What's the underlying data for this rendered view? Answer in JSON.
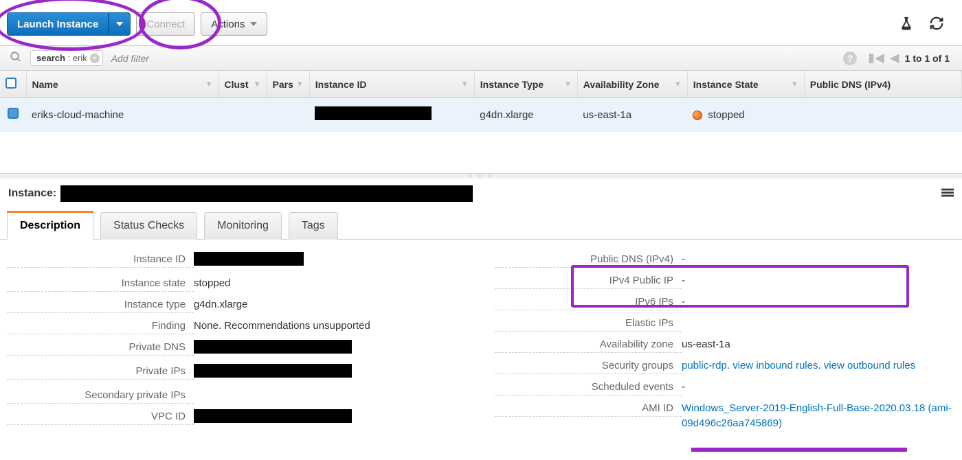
{
  "actions": {
    "launch": "Launch Instance",
    "connect": "Connect",
    "actions": "Actions"
  },
  "filter": {
    "chip_key": "search",
    "chip_value": "erik",
    "add_filter_placeholder": "Add filter",
    "pager": "1 to 1 of 1"
  },
  "table": {
    "headers": {
      "name": "Name",
      "cluster": "Clust",
      "pars": "Pars",
      "instance_id": "Instance ID",
      "instance_type": "Instance Type",
      "az": "Availability Zone",
      "state": "Instance State",
      "pdns": "Public DNS (IPv4)"
    },
    "rows": [
      {
        "name": "eriks-cloud-machine",
        "cluster": "",
        "pars": "",
        "instance_id": "[redacted]",
        "instance_type": "g4dn.xlarge",
        "az": "us-east-1a",
        "state": "stopped",
        "pdns": ""
      }
    ]
  },
  "detail": {
    "header_label": "Instance:",
    "header_value": "[redacted]",
    "tabs": [
      "Description",
      "Status Checks",
      "Monitoring",
      "Tags"
    ],
    "left": {
      "instance_id": {
        "label": "Instance ID",
        "value": "[redacted]"
      },
      "instance_state": {
        "label": "Instance state",
        "value": "stopped"
      },
      "instance_type": {
        "label": "Instance type",
        "value": "g4dn.xlarge"
      },
      "finding": {
        "label": "Finding",
        "value": "None. Recommendations unsupported"
      },
      "private_dns": {
        "label": "Private DNS",
        "value": "[redacted]"
      },
      "private_ips": {
        "label": "Private IPs",
        "value": "[redacted]"
      },
      "secondary_private_ips": {
        "label": "Secondary private IPs",
        "value": ""
      },
      "vpc_id": {
        "label": "VPC ID",
        "value": "[redacted]"
      }
    },
    "right": {
      "public_dns": {
        "label": "Public DNS (IPv4)",
        "value": "-"
      },
      "public_ip": {
        "label": "IPv4 Public IP",
        "value": "-"
      },
      "ipv6": {
        "label": "IPv6 IPs",
        "value": "-"
      },
      "elastic_ips": {
        "label": "Elastic IPs",
        "value": ""
      },
      "az": {
        "label": "Availability zone",
        "value": "us-east-1a"
      },
      "security_groups": {
        "label": "Security groups",
        "link1": "public-rdp",
        "link2": "view inbound rules",
        "link3": "view outbound rules"
      },
      "scheduled_events": {
        "label": "Scheduled events",
        "value": "-"
      },
      "ami_id": {
        "label": "AMI ID",
        "value": "Windows_Server-2019-English-Full-Base-2020.03.18 (ami-09d496c26aa745869)"
      }
    }
  }
}
